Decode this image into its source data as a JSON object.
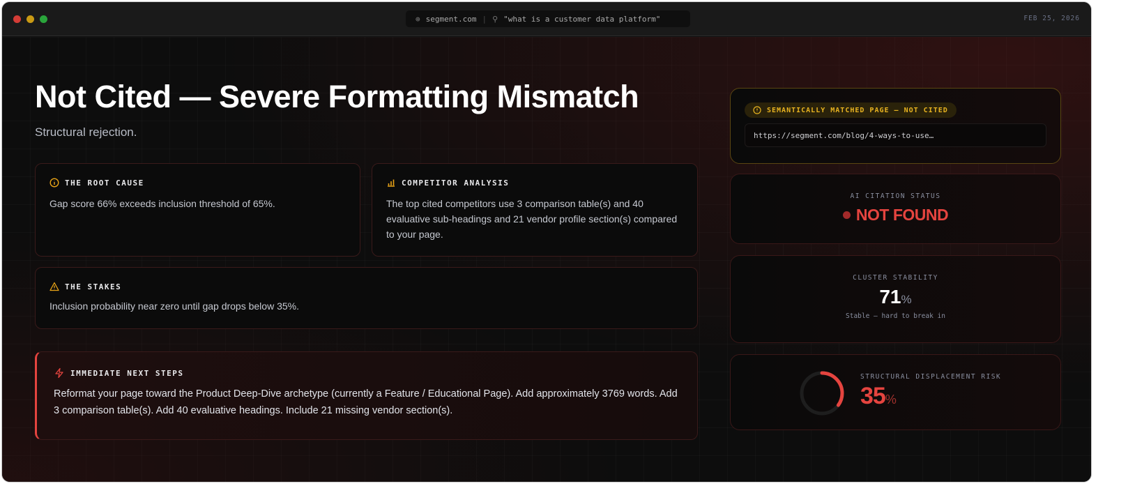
{
  "window": {
    "domain": "segment.com",
    "query": "\"what is a customer data platform\"",
    "date": "FEB 25, 2026"
  },
  "header": {
    "title": "Not Cited — Severe Formatting Mismatch",
    "subtitle": "Structural rejection."
  },
  "cards": {
    "root_cause": {
      "title": "THE ROOT CAUSE",
      "body": "Gap score 66% exceeds inclusion threshold of 65%."
    },
    "competitor": {
      "title": "COMPETITOR ANALYSIS",
      "body": "The top cited competitors use 3 comparison table(s) and 40 evaluative sub-headings and 21 vendor profile section(s) compared to your page."
    },
    "stakes": {
      "title": "THE STAKES",
      "body": "Inclusion probability near zero until gap drops below 35%."
    },
    "next_steps": {
      "title": "IMMEDIATE NEXT STEPS",
      "body": "Reformat your page toward the Product Deep-Dive archetype (currently a Feature / Educational Page). Add approximately 3769 words. Add 3 comparison table(s). Add 40 evaluative headings. Include 21 missing vendor section(s)."
    }
  },
  "side": {
    "matched": {
      "badge": "SEMANTICALLY MATCHED PAGE — NOT CITED",
      "url": "https://segment.com/blog/4-ways-to-use…"
    },
    "citation": {
      "label": "AI CITATION STATUS",
      "value": "NOT FOUND"
    },
    "stability": {
      "label": "CLUSTER STABILITY",
      "value": "71",
      "unit": "%",
      "note": "Stable — hard to break in"
    },
    "risk": {
      "label": "STRUCTURAL DISPLACEMENT RISK",
      "value": "35",
      "unit": "%",
      "fraction": 0.35
    }
  },
  "colors": {
    "accent": "#e5443f",
    "warn": "#e8b320"
  }
}
